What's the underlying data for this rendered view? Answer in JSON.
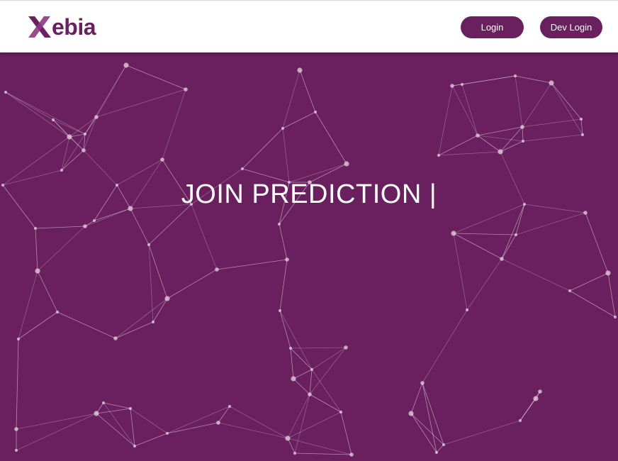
{
  "header": {
    "logo_text": "ebia",
    "login_label": "Login",
    "dev_login_label": "Dev Login"
  },
  "hero": {
    "title": "JOIN PREDICTION |",
    "background_color": "#6a1f5e",
    "accent_color": "#6a1f5e",
    "decoration": "particle-network"
  }
}
